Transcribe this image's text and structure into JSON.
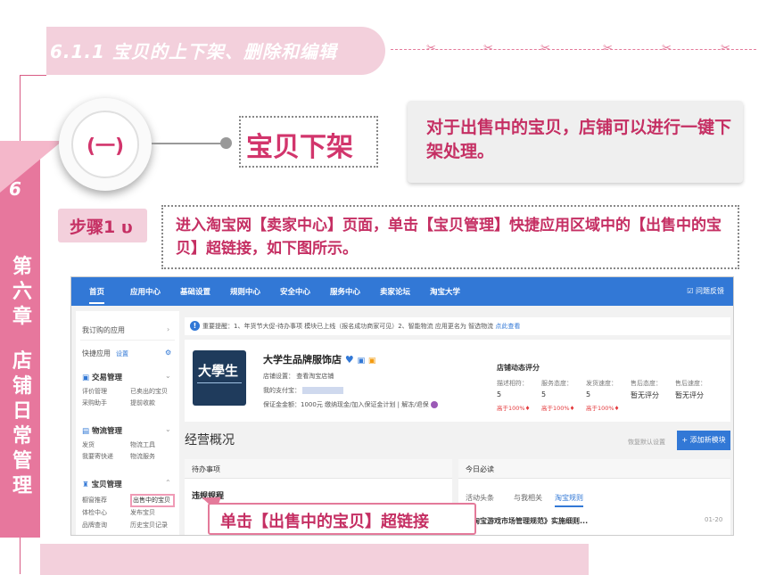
{
  "slide": {
    "section_title": "6.1.1 宝贝的上下架、删除和编辑",
    "chapter_number": "6",
    "chapter_title": "第六章 店铺日常管理",
    "chapter_title_lines": [
      "第",
      "六",
      "章",
      "",
      "店",
      "铺",
      "日",
      "常",
      "管",
      "理"
    ],
    "circle_label": "(一)",
    "heading": "宝贝下架",
    "description": "对于出售中的宝贝，店铺可以进行一键下架处理。",
    "step_label": "步骤1",
    "step_icon": "υ",
    "step_instruction": "进入淘宝网【卖家中心】页面，单击【宝贝管理】快捷应用区域中的【出售中的宝贝】超链接，如下图所示。",
    "callout": "单击【出售中的宝贝】超链接",
    "accent_color": "#d2356c",
    "band_color": "#f3d0dc",
    "sidebar_color": "#e7779d"
  },
  "screenshot": {
    "nav": [
      "首页",
      "应用中心",
      "基础设置",
      "规则中心",
      "安全中心",
      "服务中心",
      "卖家论坛",
      "淘宝大学"
    ],
    "feedback": "问题反馈",
    "sidebar": {
      "my_apps": "我订购的应用",
      "quick_apps": "快捷应用",
      "quick_settings": "设置",
      "groups": [
        {
          "title": "交易管理",
          "items": [
            "评价管理",
            "已卖出的宝贝",
            "采购助手",
            "提前收款"
          ]
        },
        {
          "title": "物流管理",
          "items": [
            "发货",
            "物流工具",
            "我要寄快递",
            "物流服务"
          ]
        },
        {
          "title": "宝贝管理",
          "items": [
            "橱窗推荐",
            "出售中的宝贝",
            "体检中心",
            "发布宝贝",
            "品牌查询",
            "历史宝贝记录"
          ]
        }
      ]
    },
    "notice": {
      "text": "重要提醒：1、年货节大促-待办事项 模块已上线（报名成功商家可见）2、智能物流 应用更名为 智选物流",
      "link": "点此查看"
    },
    "shop": {
      "logo_text": "大學生",
      "name": "大学生品牌服饰店",
      "settings_label": "店铺设置：",
      "settings_link": "查看淘宝店铺",
      "alipay_label": "我的支付宝：",
      "deposit": "保证金金额：1000元 缴纳现金/加入保证金计划 | 解冻/退保"
    },
    "rating": {
      "title": "店铺动态评分",
      "columns": [
        "描述相符：",
        "服务态度：",
        "发货速度：",
        "售后态度：",
        "售后速度："
      ],
      "values": [
        "5",
        "5",
        "5",
        "暂无评分",
        "暂无评分"
      ],
      "percents": [
        "高于100%♦",
        "高于100%♦",
        "高于100%♦"
      ]
    },
    "overview": {
      "title": "经营概况",
      "restore": "恢复默认设置",
      "add_module": "+ 添加新模块"
    },
    "todo": {
      "title": "待办事项",
      "sub": "违规规程"
    },
    "today": {
      "title": "今日必读",
      "tabs": [
        "活动头条",
        "与我相关",
        "淘宝规则"
      ],
      "news": "《淘宝游戏市场管理规范》实施细则...",
      "date": "01-20"
    }
  }
}
